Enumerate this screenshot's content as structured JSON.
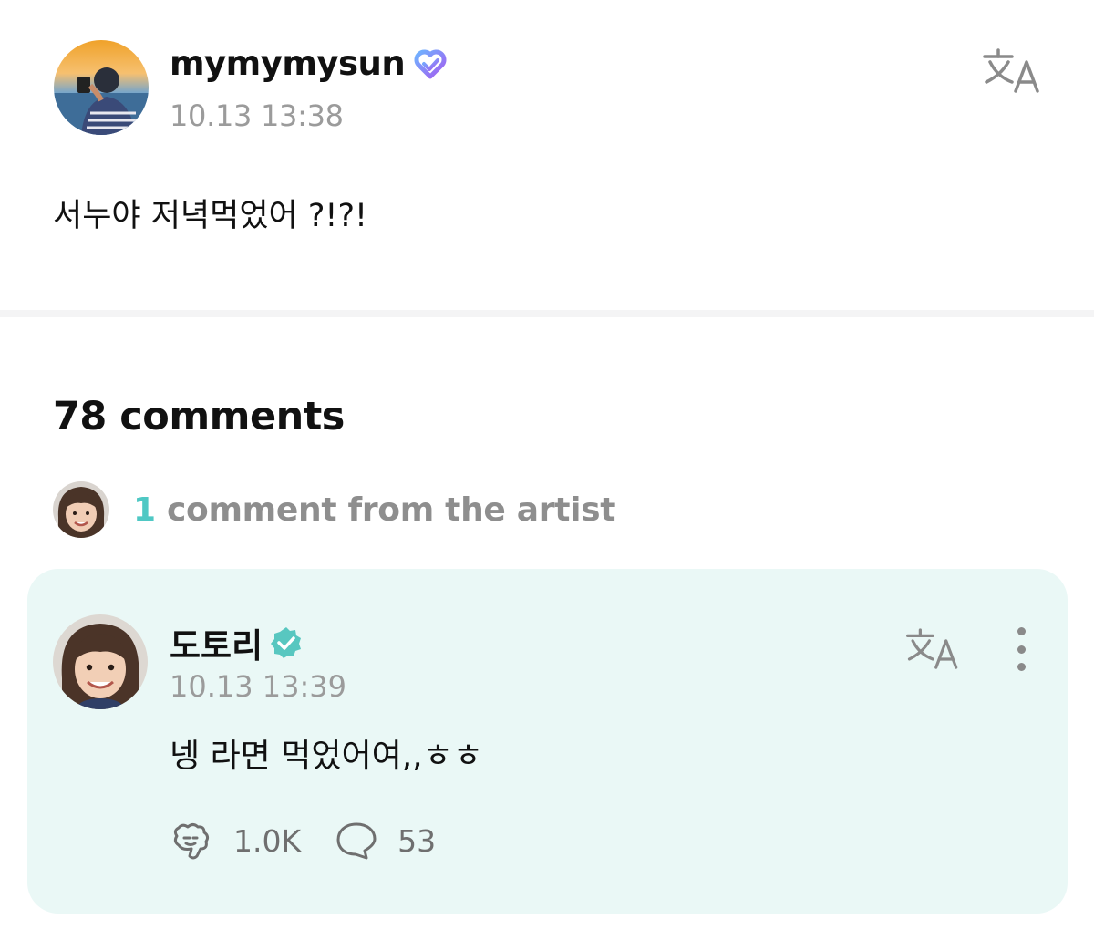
{
  "post": {
    "username": "mymymysun",
    "timestamp": "10.13 13:38",
    "body": "서누야 저녁먹었어 ?!?!",
    "translate_icon": "translate-icon",
    "badge_icon": "heart-verified-icon",
    "badge_color": "#8a7cf0"
  },
  "comments": {
    "title": "78 comments",
    "artist_summary_count": "1",
    "artist_summary_text": " comment from the artist",
    "accent_color": "#4fc8c4"
  },
  "artist_comment": {
    "name": "도토리",
    "timestamp": "10.13 13:39",
    "body": "넹 라면 먹었어여,,ㅎㅎ",
    "likes": "1.0K",
    "replies": "53",
    "badge_icon": "verified-check-icon",
    "like_icon": "like-icon",
    "reply_icon": "speech-bubble-icon",
    "more_icon": "more-vertical-icon",
    "card_color": "#eaf8f6"
  }
}
